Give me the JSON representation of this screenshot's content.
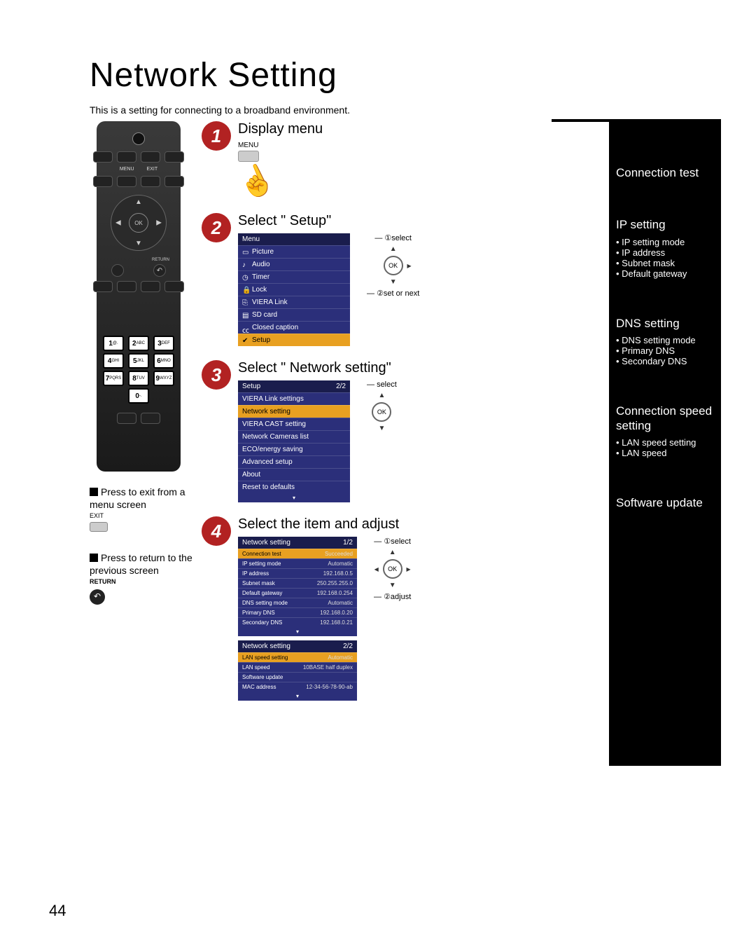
{
  "page": {
    "title": "Network Setting",
    "intro": "This is a setting for connecting to a broadband environment.",
    "number": "44"
  },
  "remote": {
    "menu_label": "MENU",
    "exit_label": "EXIT",
    "ok_label": "OK",
    "return_label": "RETURN",
    "keys": [
      "1 @.",
      "2 ABC",
      "3 DEF",
      "4 GHI",
      "5 JKL",
      "6 MNO",
      "7 PQRS",
      "8 TUV",
      "9 WXYZ",
      "0 -."
    ]
  },
  "notes": {
    "exit_title": "Press to exit from a menu screen",
    "exit_label": "EXIT",
    "return_title": "Press to return to the previous screen",
    "return_label": "RETURN"
  },
  "steps": {
    "s1": {
      "title": "Display menu",
      "menu_label": "MENU"
    },
    "s2": {
      "title": "Select \" Setup\"",
      "panel_header": "Menu",
      "items": [
        "Picture",
        "Audio",
        "Timer",
        "Lock",
        "VIERA Link",
        "SD card",
        "Closed caption",
        "Setup"
      ],
      "nav1": "①select",
      "nav2": "②set or next"
    },
    "s3": {
      "title": "Select \" Network setting\"",
      "panel_header": "Setup",
      "panel_page": "2/2",
      "items": [
        "VIERA Link settings",
        "Network setting",
        "VIERA CAST setting",
        "Network Cameras list",
        "ECO/energy saving",
        "Advanced setup",
        "About",
        "Reset to defaults"
      ],
      "nav1": "select"
    },
    "s4": {
      "title": "Select the item and adjust",
      "panel_header": "Network setting",
      "panel_page_1": "1/2",
      "panel_page_2": "2/2",
      "rows1": [
        {
          "k": "Connection test",
          "v": "Succeeded"
        },
        {
          "k": "IP setting mode",
          "v": "Automatic"
        },
        {
          "k": "IP address",
          "v": "192.168.0.5"
        },
        {
          "k": "Subnet mask",
          "v": "250.255.255.0"
        },
        {
          "k": "Default gateway",
          "v": "192.168.0.254"
        },
        {
          "k": "DNS setting mode",
          "v": "Automatic"
        },
        {
          "k": "Primary DNS",
          "v": "192.168.0.20"
        },
        {
          "k": "Secondary DNS",
          "v": "192.168.0.21"
        }
      ],
      "rows2": [
        {
          "k": "LAN speed setting",
          "v": "Automatic"
        },
        {
          "k": "LAN speed",
          "v": "10BASE half duplex"
        },
        {
          "k": "Software update",
          "v": ""
        },
        {
          "k": "MAC address",
          "v": "12-34-56-78-90-ab"
        }
      ],
      "nav1": "①select",
      "nav2": "②adjust"
    }
  },
  "sidebar": {
    "s1": {
      "h": "Connection test"
    },
    "s2": {
      "h": "IP setting",
      "items": [
        "IP setting mode",
        "IP address",
        "Subnet mask",
        "Default gateway"
      ]
    },
    "s3": {
      "h": "DNS setting",
      "items": [
        "DNS setting mode",
        "Primary DNS",
        "Secondary DNS"
      ]
    },
    "s4": {
      "h": "Connection speed setting",
      "items": [
        "LAN speed setting",
        "LAN speed"
      ]
    },
    "s5": {
      "h": "Software update"
    }
  }
}
